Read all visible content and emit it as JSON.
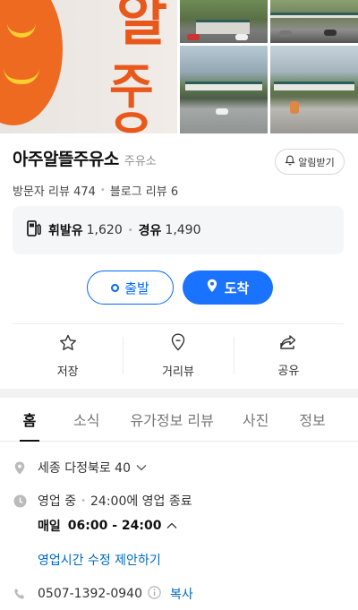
{
  "gallery": {
    "photo_main_glyphs": [
      "알",
      "주유"
    ]
  },
  "place": {
    "name": "아주알뜰주유소",
    "category": "주유소",
    "alarm_label": "알림받기",
    "visitor_reviews": "방문자 리뷰 474",
    "blog_reviews": "블로그 리뷰 6"
  },
  "prices": [
    {
      "fuel": "휘발유",
      "price": "1,620"
    },
    {
      "fuel": "경유",
      "price": "1,490"
    }
  ],
  "route": {
    "start_label": "출발",
    "dest_label": "도착"
  },
  "actions": [
    {
      "label": "저장",
      "icon": "star-icon"
    },
    {
      "label": "거리뷰",
      "icon": "location-pin-icon"
    },
    {
      "label": "공유",
      "icon": "share-icon"
    }
  ],
  "tabs": [
    {
      "label": "홈",
      "active": true
    },
    {
      "label": "소식"
    },
    {
      "label": "유가정보 리뷰"
    },
    {
      "label": "사진"
    },
    {
      "label": "정보"
    }
  ],
  "info": {
    "address": "세종 다정북로 40",
    "status": "영업 중",
    "closing": "24:00에 영업 종료",
    "hours_day": "매일",
    "hours_time": "06:00 - 24:00",
    "suggest_link": "영업시간 수정 제안하기",
    "phone": "0507-1392-0940",
    "copy_label": "복사"
  },
  "colors": {
    "accent_blue": "#1a73ff",
    "link_blue": "#0068c3",
    "brand_orange": "#ee6a21"
  }
}
